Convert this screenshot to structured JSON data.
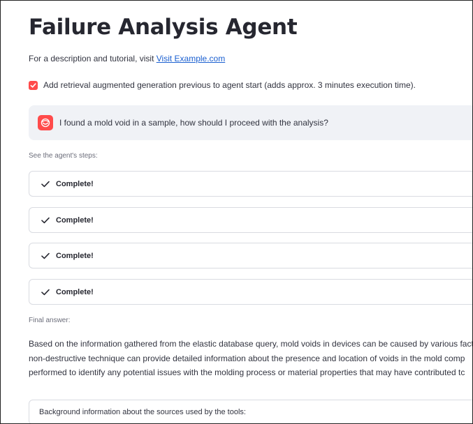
{
  "page": {
    "title": "Failure Analysis Agent",
    "intro_text": "For a description and tutorial, visit ",
    "intro_link": "Visit Example.com"
  },
  "rag_option": {
    "checked": true,
    "label": "Add retrieval augmented generation previous to agent start (adds approx. 3 minutes execution time)."
  },
  "user_message": {
    "avatar_icon": "smiley-face-icon",
    "text": "I found a mold void in a sample, how should I proceed with the analysis?"
  },
  "steps_caption": "See the agent's steps:",
  "steps": [
    {
      "status": "Complete!",
      "icon": "checkmark-icon"
    },
    {
      "status": "Complete!",
      "icon": "checkmark-icon"
    },
    {
      "status": "Complete!",
      "icon": "checkmark-icon"
    },
    {
      "status": "Complete!",
      "icon": "checkmark-icon"
    }
  ],
  "final_caption": "Final answer:",
  "final_answer_lines": [
    "Based on the information gathered from the elastic database query, mold voids in devices can be caused by various fact",
    "non-destructive technique can provide detailed information about the presence and location of voids in the mold comp",
    "performed to identify any potential issues with the molding process or material properties that may have contributed tc"
  ],
  "sources_expander": {
    "label": "Background information about the sources used by the tools:"
  },
  "colors": {
    "accent": "#ff4b4b",
    "chat_bg": "#f0f2f6",
    "link": "#1a5fd0",
    "border": "#d9dbe1"
  }
}
